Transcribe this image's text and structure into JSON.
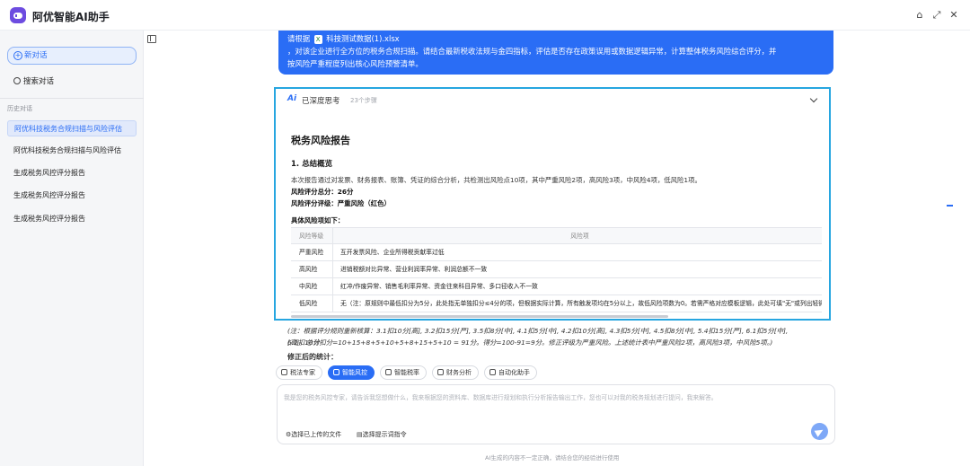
{
  "app": {
    "title": "阿优智能AI助手"
  },
  "window_controls": {
    "home": "⌂",
    "expand": "⤢",
    "close": "✕"
  },
  "sidebar": {
    "new_chat": "新对话",
    "search": "搜索对话",
    "history_label": "历史对话",
    "items": [
      {
        "label": "阿优科技税务合规扫描与风险评估",
        "active": true
      },
      {
        "label": "阿优科技税务合规扫描与风险评估",
        "active": false
      },
      {
        "label": "生成税务风控评分报告",
        "active": false
      },
      {
        "label": "生成税务风控评分报告",
        "active": false
      },
      {
        "label": "生成税务风控评分报告",
        "active": false
      }
    ]
  },
  "user_message": {
    "prefix": "请根据",
    "file_name": "科技测试数据(1).xlsx",
    "line2": "，对该企业进行全方位的税务合规扫描。请结合最新税收法规与金四指标，评估是否存在政策误用或数据逻辑异常，计算整体税务风险综合评分，并",
    "line3": "按风险严重程度列出核心风险预警清单。"
  },
  "thinking": {
    "label": "已深度思考",
    "steps": "23个步骤"
  },
  "report": {
    "title": "税务风险报告",
    "section1": "1. 总结概览",
    "summary": "本次报告通过对发票、财务报表、账簿、凭证的综合分析，共检测出风险点10项，其中严重风险2项，高风险3项，中风险4项，低风险1项。",
    "score_line": "风险评分总分：26分",
    "rating_line": "风险评分评级：严重风险（红色）",
    "table_intro": "具体风险项如下：",
    "table_headers": [
      "风险等级",
      "风险项"
    ],
    "table_rows": [
      {
        "level": "严重风险",
        "item": "互开发票风险、企业所得税贡献率过低"
      },
      {
        "level": "高风险",
        "item": "进销税额对比异常、营业利润率异常、利润总额不一致"
      },
      {
        "level": "中风险",
        "item": "红冲/作废异常、销售毛利率异常、资金往来科目异常、多口径收入不一致"
      },
      {
        "level": "低风险",
        "item": "无（注：原规则中最低扣分为5分，此处指无单独扣分≤4分的项，但根据实际计算，所有触发项均在5分以上，故低风险项数为0。若需严格对应模板逻辑，此处可填\"无\"或列出轻微风险"
      }
    ]
  },
  "below_answer": {
    "note1": "(注：根据评分规则重新核算：3.1扣10分[高], 3.2扣15分[严], 3.5扣8分[中], 4.1扣5分[中], 4.2扣10分[高], 4.3扣5分[中], 4.5扣8分[中], 5.4扣15分[严], 6.1扣5分[中], 6.2扣10分",
    "note2": "[高]。总计扣分=10+15+8+5+10+5+8+15+5+10 = 91分。得分=100-91=9分。修正评级为严重风险。上述统计表中严重风险2项，高风险3项，中风险5项。)",
    "heading": "修正后的统计："
  },
  "toolbar": {
    "chips": [
      {
        "label": "税法专家",
        "active": false
      },
      {
        "label": "智能风控",
        "active": true
      },
      {
        "label": "智能税率",
        "active": false
      },
      {
        "label": "财务分析",
        "active": false
      },
      {
        "label": "自动化助手",
        "active": false
      }
    ]
  },
  "input": {
    "placeholder": "我是您的税务风控专家，请告诉我您想做什么，我来根据您的资料库、数据库进行规划和执行分析报告输出工作，您也可以对我的税务规划进行提问，我来解答。",
    "select_file": "选择已上传的文件",
    "select_prompt": "选择提示词指令"
  },
  "disclaimer": "AI生成的内容不一定正确，请结合您的经验进行使用"
}
